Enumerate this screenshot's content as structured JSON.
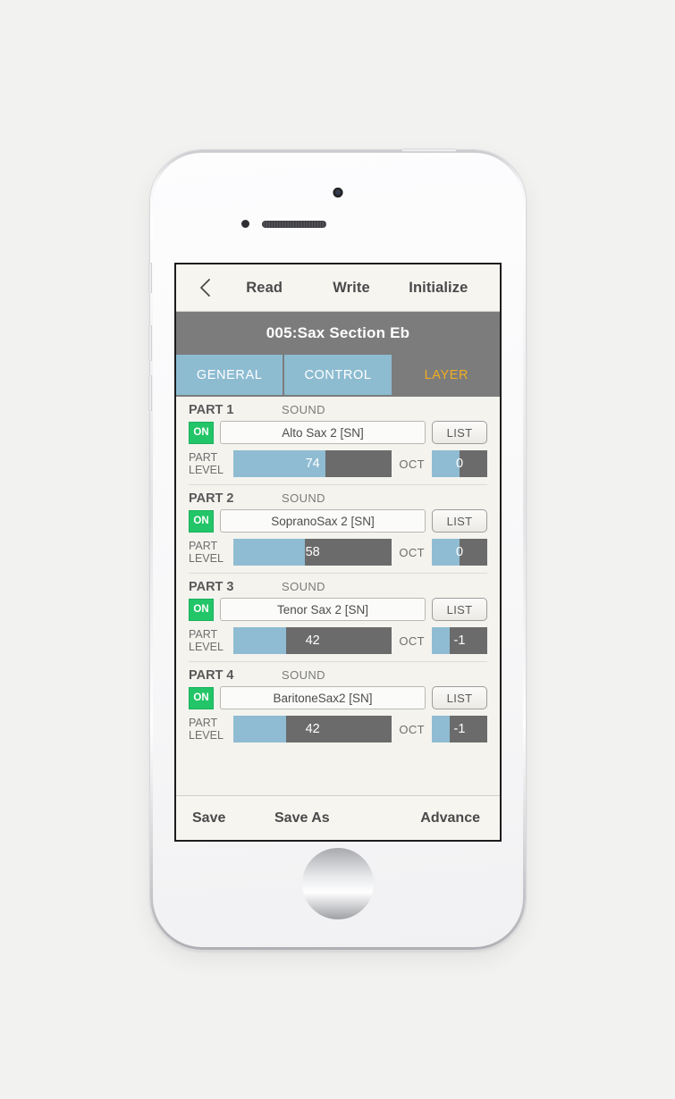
{
  "device": {
    "camera_icon": "front-camera-icon",
    "sensor_icon": "proximity-sensor-icon",
    "speaker_icon": "earpiece-speaker-icon",
    "home_icon": "home-button-icon"
  },
  "nav": {
    "back_icon": "chevron-left-icon",
    "read": "Read",
    "write": "Write",
    "initialize": "Initialize"
  },
  "title": "005:Sax Section Eb",
  "tabs": [
    {
      "label": "GENERAL",
      "active": false
    },
    {
      "label": "CONTROL",
      "active": false
    },
    {
      "label": "LAYER",
      "active": true
    }
  ],
  "labels": {
    "sound": "SOUND",
    "part_level": "PART\nLEVEL",
    "part_level_line1": "PART",
    "part_level_line2": "LEVEL",
    "oct": "OCT",
    "on": "ON",
    "list": "LIST"
  },
  "parts": [
    {
      "title": "PART 1",
      "sound_label": "SOUND",
      "on": "ON",
      "sound": "Alto Sax 2 [SN]",
      "list": "LIST",
      "level_label_1": "PART",
      "level_label_2": "LEVEL",
      "level_value": "74",
      "level_percent": 58,
      "oct_label": "OCT",
      "oct_value": "0",
      "oct_percent": 50
    },
    {
      "title": "PART 2",
      "sound_label": "SOUND",
      "on": "ON",
      "sound": "SopranoSax 2 [SN]",
      "list": "LIST",
      "level_label_1": "PART",
      "level_label_2": "LEVEL",
      "level_value": "58",
      "level_percent": 45,
      "oct_label": "OCT",
      "oct_value": "0",
      "oct_percent": 50
    },
    {
      "title": "PART 3",
      "sound_label": "SOUND",
      "on": "ON",
      "sound": "Tenor Sax 2 [SN]",
      "list": "LIST",
      "level_label_1": "PART",
      "level_label_2": "LEVEL",
      "level_value": "42",
      "level_percent": 33,
      "oct_label": "OCT",
      "oct_value": "-1",
      "oct_percent": 33
    },
    {
      "title": "PART 4",
      "sound_label": "SOUND",
      "on": "ON",
      "sound": "BaritoneSax2 [SN]",
      "list": "LIST",
      "level_label_1": "PART",
      "level_label_2": "LEVEL",
      "level_value": "42",
      "level_percent": 33,
      "oct_label": "OCT",
      "oct_value": "-1",
      "oct_percent": 33
    }
  ],
  "bottom": {
    "save": "Save",
    "save_as": "Save As",
    "advance": "Advance"
  },
  "colors": {
    "accent_blue": "#8fbcd2",
    "active_tab_text": "#f0ad22",
    "on_green": "#22c567",
    "slider_track": "#6b6b6b",
    "title_bar": "#7c7c7c",
    "screen_bg": "#f4f3ee",
    "bar_bg": "#f6f5f0",
    "page_bg": "#f2f2f1"
  }
}
